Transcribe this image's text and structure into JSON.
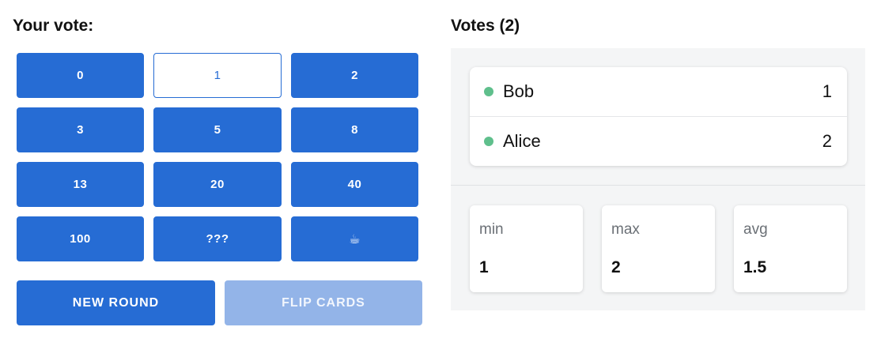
{
  "left": {
    "heading": "Your vote:",
    "cards": [
      "0",
      "1",
      "2",
      "3",
      "5",
      "8",
      "13",
      "20",
      "40",
      "100",
      "???",
      "☕"
    ],
    "selected_card": "1",
    "new_round_label": "NEW ROUND",
    "flip_cards_label": "FLIP CARDS"
  },
  "right": {
    "heading": "Votes (2)",
    "votes": [
      {
        "name": "Bob",
        "vote": "1"
      },
      {
        "name": "Alice",
        "vote": "2"
      }
    ],
    "stats": {
      "min_label": "min",
      "min_value": "1",
      "max_label": "max",
      "max_value": "2",
      "avg_label": "avg",
      "avg_value": "1.5"
    }
  },
  "colors": {
    "primary": "#266cd4",
    "primary_disabled": "#93b4e8",
    "online_dot": "#5fbf8c",
    "panel_bg": "#f4f5f6"
  }
}
